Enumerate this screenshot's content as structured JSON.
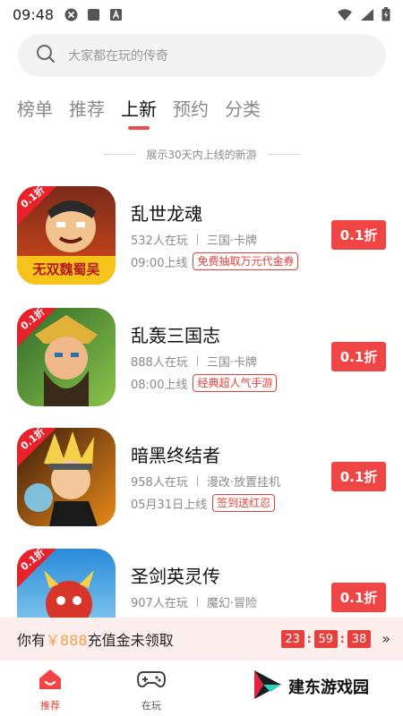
{
  "status_bar": {
    "time": "09:48"
  },
  "search": {
    "placeholder": "大家都在玩的传奇"
  },
  "tabs": [
    {
      "label": "榜单"
    },
    {
      "label": "推荐"
    },
    {
      "label": "上新",
      "active": true
    },
    {
      "label": "预约"
    },
    {
      "label": "分类"
    }
  ],
  "section_caption": "展示30天内上线的新游",
  "games": [
    {
      "name": "乱世龙魂",
      "players": "532人在玩",
      "genre": "三国·卡牌",
      "online_time": "09:00上线",
      "tag": "免费抽取万元代金券",
      "discount": "0.1折",
      "icon_badge": "0.1折",
      "icon_logo_text": "无双魏蜀吴"
    },
    {
      "name": "乱轰三国志",
      "players": "888人在玩",
      "genre": "三国·卡牌",
      "online_time": "08:00上线",
      "tag": "经典超人气手游",
      "discount": "0.1折",
      "icon_badge": "0.1折"
    },
    {
      "name": "暗黑终结者",
      "players": "958人在玩",
      "genre": "漫改·放置挂机",
      "online_time": "05月31日上线",
      "tag": "签到送红忍",
      "discount": "0.1折",
      "icon_badge": "0.1折"
    },
    {
      "name": "圣剑英灵传",
      "players": "907人在玩",
      "genre": "魔幻·冒险",
      "discount": "0.1折",
      "icon_badge": "0.1折"
    }
  ],
  "promo": {
    "prefix": "你有",
    "amount": "￥888",
    "suffix": "充值金未领取",
    "hours": "23",
    "minutes": "59",
    "seconds": "38",
    "arrow": "»"
  },
  "bottom_nav": [
    {
      "label": "推荐",
      "icon": "home-icon",
      "active": true
    },
    {
      "label": "在玩",
      "icon": "gamepad-icon"
    }
  ],
  "watermark": {
    "text": "建东游戏园"
  },
  "colors": {
    "accent": "#f04545",
    "tab_indicator": "#f04b4b",
    "promo_bg": "#fdeeee",
    "amount": "#f0a04b"
  }
}
